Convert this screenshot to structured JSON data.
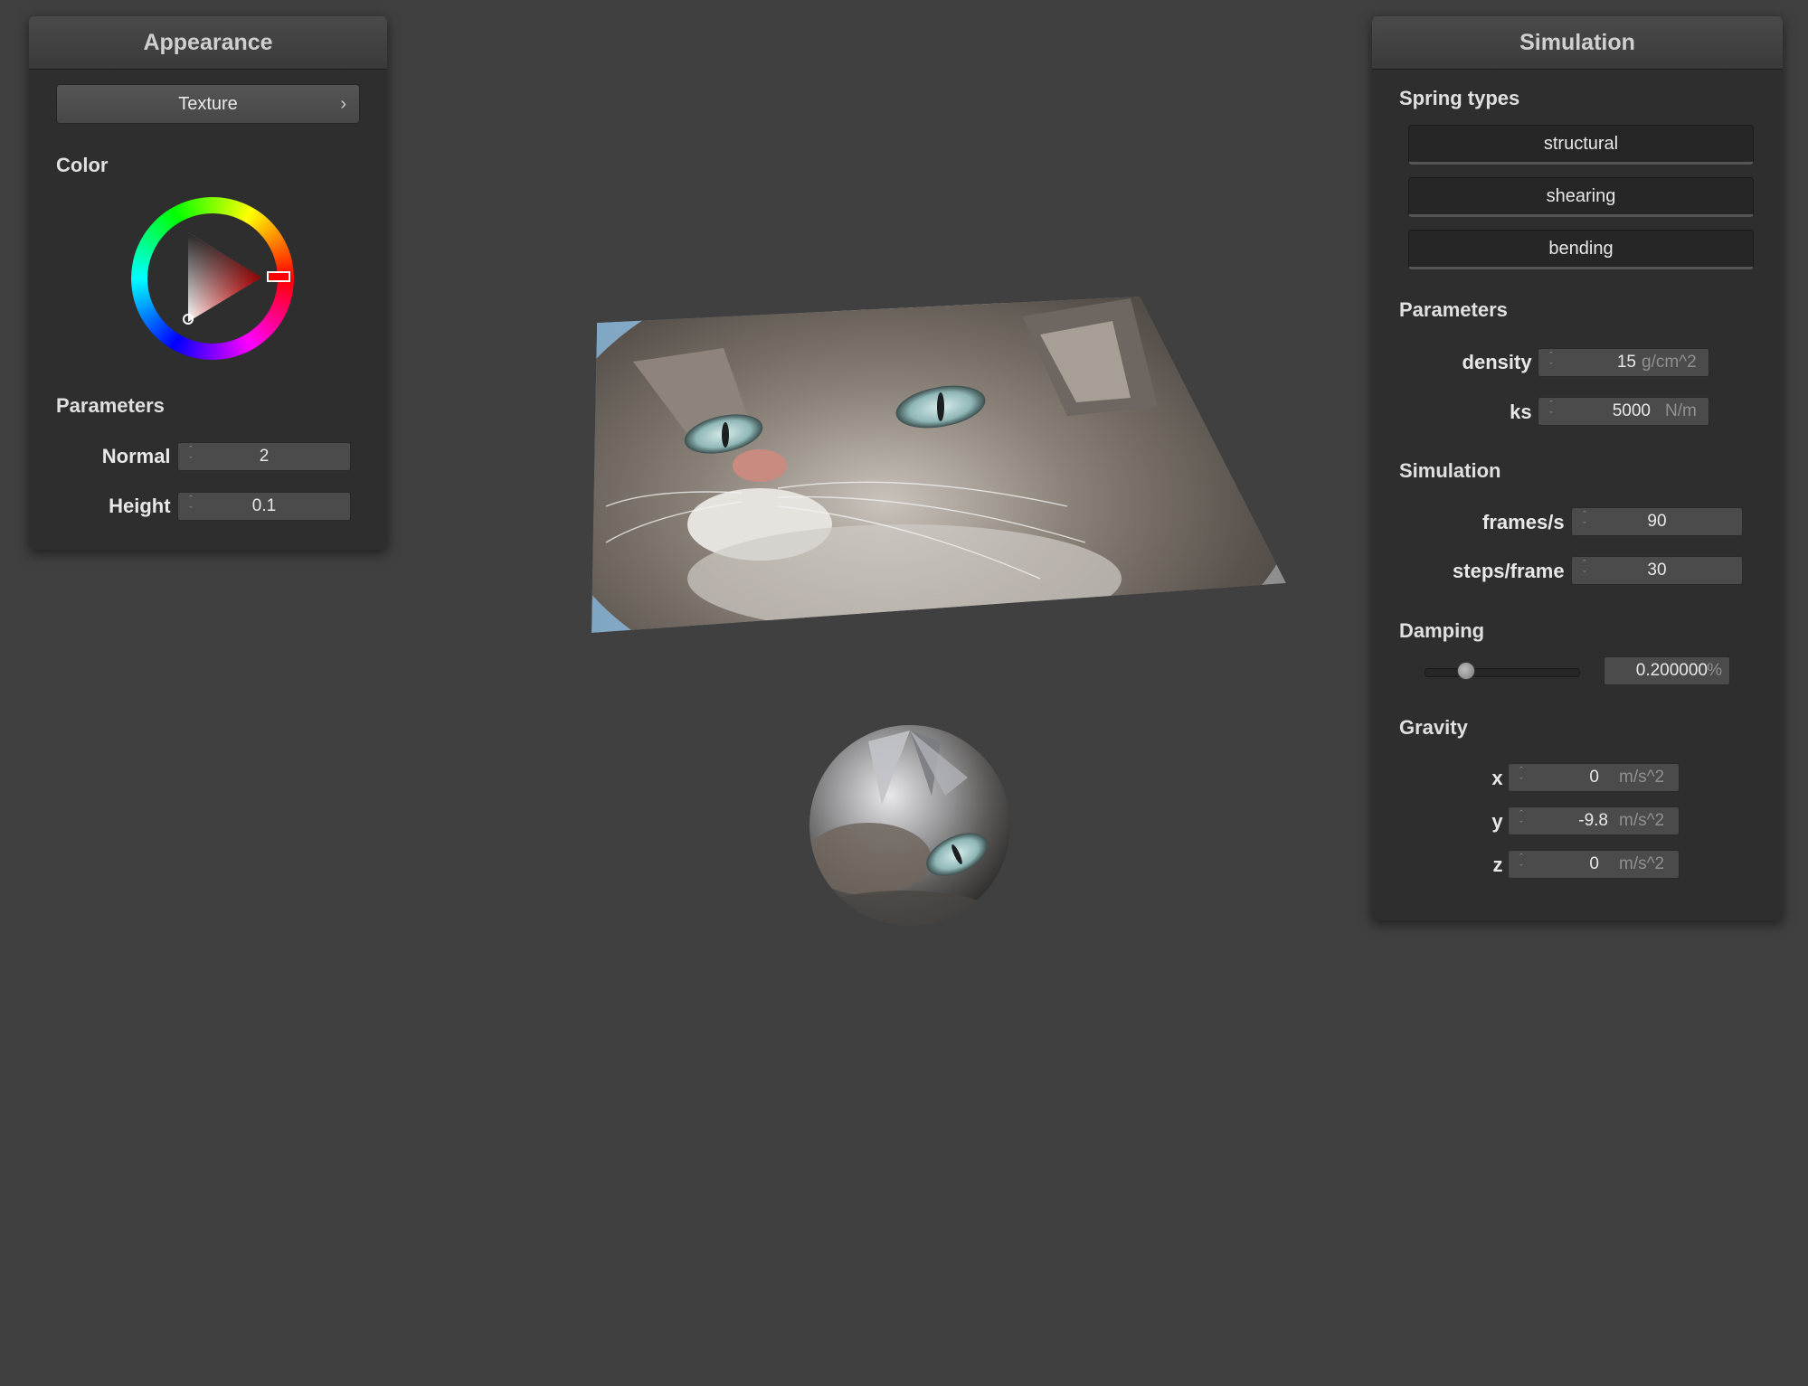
{
  "appearance": {
    "title": "Appearance",
    "texture_button": "Texture",
    "texture_chevron": "›",
    "color_label": "Color",
    "params_label": "Parameters",
    "normal_label": "Normal :",
    "normal_value": "2",
    "height_label": "Height :",
    "height_value": "0.1",
    "selected_color": "#ff0000"
  },
  "simulation": {
    "title": "Simulation",
    "spring_types_label": "Spring types",
    "spring_buttons": [
      "structural",
      "shearing",
      "bending"
    ],
    "params_label": "Parameters",
    "density_label": "density :",
    "density_value": "15",
    "density_unit": "g/cm^2",
    "ks_label": "ks :",
    "ks_value": "5000",
    "ks_unit": "N/m",
    "sim_label": "Simulation",
    "fps_label": "frames/s :",
    "fps_value": "90",
    "steps_label": "steps/frame :",
    "steps_value": "30",
    "damping_label": "Damping",
    "damping_value": "0.200000",
    "damping_unit": "%",
    "damping_fraction": 0.2,
    "gravity_label": "Gravity",
    "gx_label": "x :",
    "gx_value": "0",
    "gy_label": "y :",
    "gy_value": "-9.8",
    "gz_label": "z :",
    "gz_value": "0",
    "gravity_unit": "m/s^2"
  }
}
